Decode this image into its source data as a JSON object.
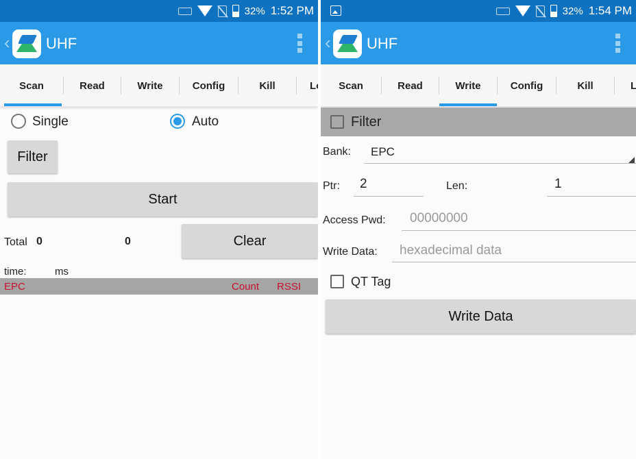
{
  "left_screen": {
    "statusbar": {
      "battery": "32%",
      "time": "1:52 PM"
    },
    "app_title": "UHF",
    "tabs": [
      "Scan",
      "Read",
      "Write",
      "Config",
      "Kill",
      "Lo"
    ],
    "active_tab": "Scan",
    "mode_single_label": "Single",
    "mode_auto_label": "Auto",
    "selected_mode": "Auto",
    "filter_button": "Filter",
    "start_button": "Start",
    "total_label": "Total",
    "total_value": "0",
    "count_value": "0",
    "clear_button": "Clear",
    "time_label": "time:",
    "time_unit": "ms",
    "list_header": {
      "epc": "EPC",
      "count": "Count",
      "rssi": "RSSI"
    }
  },
  "right_screen": {
    "statusbar": {
      "battery": "32%",
      "time": "1:54 PM"
    },
    "app_title": "UHF",
    "tabs": [
      "Scan",
      "Read",
      "Write",
      "Config",
      "Kill",
      "L"
    ],
    "active_tab": "Write",
    "filter_checkbox_label": "Filter",
    "bank_label": "Bank:",
    "bank_value": "EPC",
    "ptr_label": "Ptr:",
    "ptr_value": "2",
    "len_label": "Len:",
    "len_value": "1",
    "access_pwd_label": "Access Pwd:",
    "access_pwd_placeholder": "00000000",
    "write_data_label": "Write Data:",
    "write_data_placeholder": "hexadecimal data",
    "qt_tag_label": "QT Tag",
    "write_data_button": "Write Data"
  },
  "colors": {
    "statusbar": "#0e72c0",
    "appbar": "#2b9ae6",
    "accent": "#2b9ae6",
    "list_header_text": "#c8102e"
  }
}
